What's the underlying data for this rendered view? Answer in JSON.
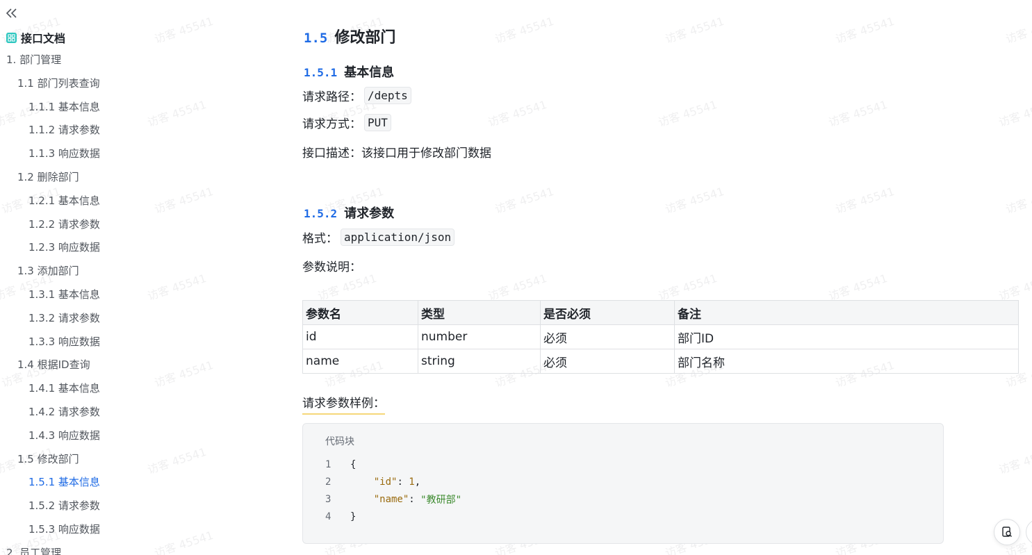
{
  "sidebar": {
    "doc_title": "接口文档",
    "toc": [
      {
        "label": "1. 部门管理",
        "level": 0
      },
      {
        "label": "1.1 部门列表查询",
        "level": 1
      },
      {
        "label": "1.1.1 基本信息",
        "level": 2
      },
      {
        "label": "1.1.2 请求参数",
        "level": 2
      },
      {
        "label": "1.1.3 响应数据",
        "level": 2
      },
      {
        "label": "1.2 删除部门",
        "level": 1
      },
      {
        "label": "1.2.1 基本信息",
        "level": 2
      },
      {
        "label": "1.2.2 请求参数",
        "level": 2
      },
      {
        "label": "1.2.3 响应数据",
        "level": 2
      },
      {
        "label": "1.3 添加部门",
        "level": 1
      },
      {
        "label": "1.3.1 基本信息",
        "level": 2
      },
      {
        "label": "1.3.2 请求参数",
        "level": 2
      },
      {
        "label": "1.3.3 响应数据",
        "level": 2
      },
      {
        "label": "1.4 根据ID查询",
        "level": 1
      },
      {
        "label": "1.4.1 基本信息",
        "level": 2
      },
      {
        "label": "1.4.2 请求参数",
        "level": 2
      },
      {
        "label": "1.4.3 响应数据",
        "level": 2
      },
      {
        "label": "1.5 修改部门",
        "level": 1
      },
      {
        "label": "1.5.1 基本信息",
        "level": 2,
        "active": true
      },
      {
        "label": "1.5.2 请求参数",
        "level": 2
      },
      {
        "label": "1.5.3 响应数据",
        "level": 2
      },
      {
        "label": "2. 员工管理",
        "level": 0
      }
    ]
  },
  "main": {
    "section_num": "1.5",
    "section_title": "修改部门",
    "sub1_num": "1.5.1",
    "sub1_title": "基本信息",
    "path_label": "请求路径：",
    "path_value": "/depts",
    "method_label": "请求方式：",
    "method_value": "PUT",
    "desc_label": "接口描述：",
    "desc_value": "该接口用于修改部门数据",
    "sub2_num": "1.5.2",
    "sub2_title": "请求参数",
    "format_label": "格式：",
    "format_value": "application/json",
    "params_label": "参数说明：",
    "table": {
      "headers": [
        "参数名",
        "类型",
        "是否必须",
        "备注"
      ],
      "rows": [
        [
          "id",
          "number",
          "必须",
          "部门ID"
        ],
        [
          "name",
          "string",
          "必须",
          "部门名称"
        ]
      ]
    },
    "sample_label": "请求参数样例：",
    "code_block": {
      "title": "代码块",
      "line_numbers": [
        "1",
        "2",
        "3",
        "4"
      ],
      "open_brace": "{",
      "key1": "\"id\"",
      "val1": "1",
      "key2": "\"name\"",
      "val2": "\"教研部\"",
      "close_brace": "}"
    }
  },
  "watermark": "访客 45541"
}
